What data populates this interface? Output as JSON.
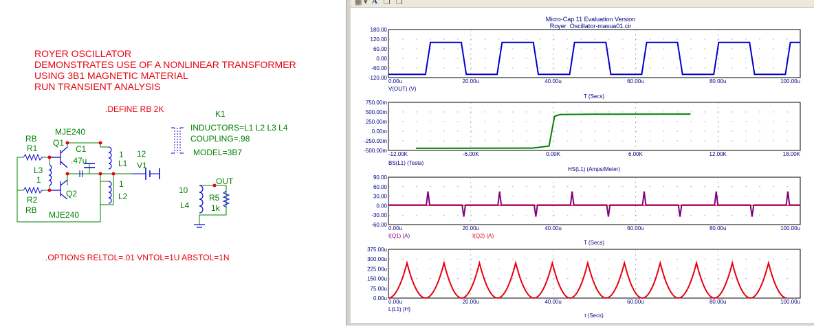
{
  "schematic": {
    "title_lines": [
      "ROYER OSCILLATOR",
      "DEMONSTRATES USE OF A NONLINEAR TRANSFORMER",
      "USING 3B1 MAGNETIC MATERIAL",
      "RUN TRANSIENT ANALYSIS"
    ],
    "define": ".DEFINE RB 2K",
    "k1_name": "K1",
    "k1_lines": [
      "INDUCTORS=L1 L2 L3 L4",
      "COUPLING=.98",
      "MODEL=3B7"
    ],
    "options": ".OPTIONS RELTOL=.01 VNTOL=1U ABSTOL=1N",
    "labels": {
      "mje_top": "MJE240",
      "mje_bot": "MJE240",
      "rb1": "RB",
      "r1": "R1",
      "r2": "R2",
      "rb2": "RB",
      "q1": "Q1",
      "q2": "Q2",
      "c1": "C1",
      "c1_val": ".47u",
      "l3": "L3",
      "l3_val": "1",
      "l1_val": "1",
      "l1": "L1",
      "l2_val": "1",
      "l2": "L2",
      "v1_val": "12",
      "v1": "V1",
      "l4_val": "10",
      "l4": "L4",
      "r5": "R5",
      "r5_val": "1k",
      "out": "OUT"
    },
    "colors": {
      "title": "#e8000f",
      "component": "#0000cc",
      "wire": "#008000",
      "label": "#008000",
      "node": "#e8000f"
    }
  },
  "plot_window": {
    "title": "Micro-Cap 11 Evaluation Version",
    "subtitle": "Royer_Oscillator-masua01.cir",
    "toolbar_icons": [
      "grid-icon",
      "chevron-down-icon",
      "text-a-icon",
      "copy-icon",
      "paste-icon"
    ],
    "toolbar_a": "A"
  },
  "chart_data": [
    {
      "type": "line",
      "x_ticks": [
        "0.00u",
        "20.00u",
        "40.00u",
        "60.00u",
        "80.00u",
        "100.00u"
      ],
      "y_ticks": [
        "180.00",
        "120.00",
        "60.00",
        "0.00",
        "-60.00",
        "-120.00"
      ],
      "xlim": [
        0,
        100
      ],
      "ylim": [
        -120,
        180
      ],
      "trace_label": "V(OUT) (V)",
      "xlabel": "T (Secs)",
      "series": [
        {
          "name": "V(OUT) (V)",
          "color": "#0000cc",
          "shape": "square",
          "high": 100,
          "low": -100,
          "edges": [
            0,
            9.6,
            18.3,
            27.0,
            35.8,
            44.6,
            53.4,
            62.1,
            70.8,
            79.6,
            88.3,
            97.0
          ]
        }
      ]
    },
    {
      "type": "line",
      "x_ticks": [
        "-12.00K",
        "-6.00K",
        "0.00K",
        "6.00K",
        "12.00K",
        "18.00K"
      ],
      "y_ticks": [
        "750.00m",
        "500.00m",
        "250.00m",
        "0.00m",
        "-250.00m",
        "-500.00m"
      ],
      "xlim": [
        -12,
        18
      ],
      "ylim": [
        -500,
        750
      ],
      "trace_label": "BS(L1) (Tesla)",
      "xlabel": "",
      "series": [
        {
          "name": "BS(L1) (Tesla)",
          "color": "#008000",
          "shape": "bh",
          "x_start": -10.0,
          "x_end": 10.0,
          "neg": -445,
          "pos": 445
        }
      ]
    },
    {
      "type": "line",
      "x_ticks": [
        "0.00u",
        "20.00u",
        "40.00u",
        "60.00u",
        "80.00u",
        "100.00u"
      ],
      "y_ticks": [
        "90.00",
        "60.00",
        "30.00",
        "0.00",
        "-30.00",
        "-60.00"
      ],
      "xlim": [
        0,
        100
      ],
      "ylim": [
        -60,
        90
      ],
      "header_label": "HS(L1) (Amps/Meter)",
      "trace_labels": [
        "I(Q1) (A)",
        "I(Q2) (A)"
      ],
      "xlabel": "T (Secs)",
      "series": [
        {
          "name": "I(Q1) (A)",
          "color": "#800080",
          "shape": "spikes",
          "base": 2,
          "spike": 45,
          "neg_spike": -35,
          "pos_at": [
            9.6,
            27.0,
            44.6,
            62.1,
            79.6,
            97.0
          ],
          "neg_at": [
            18.3,
            35.8,
            53.4,
            70.8,
            88.3
          ]
        },
        {
          "name": "I(Q2) (A)",
          "color": "#e8000f",
          "shape": "flat",
          "value": 0
        }
      ]
    },
    {
      "type": "line",
      "x_ticks": [
        "0.00u",
        "20.00u",
        "40.00u",
        "60.00u",
        "80.00u",
        "100.00u"
      ],
      "y_ticks": [
        "375.00u",
        "300.00u",
        "225.00u",
        "150.00u",
        "75.00u",
        "0.00u"
      ],
      "xlim": [
        0,
        100
      ],
      "ylim": [
        0,
        375
      ],
      "trace_label": "L(L1) (H)",
      "xlabel": "t (Secs)",
      "series": [
        {
          "name": "L(L1) (H)",
          "color": "#e8000f",
          "shape": "cusp",
          "peak": 270,
          "peaks_at": [
            4.5,
            13.5,
            22.1,
            30.9,
            39.8,
            48.4,
            57.3,
            66.0,
            74.8,
            83.5,
            92.3
          ]
        }
      ]
    }
  ]
}
